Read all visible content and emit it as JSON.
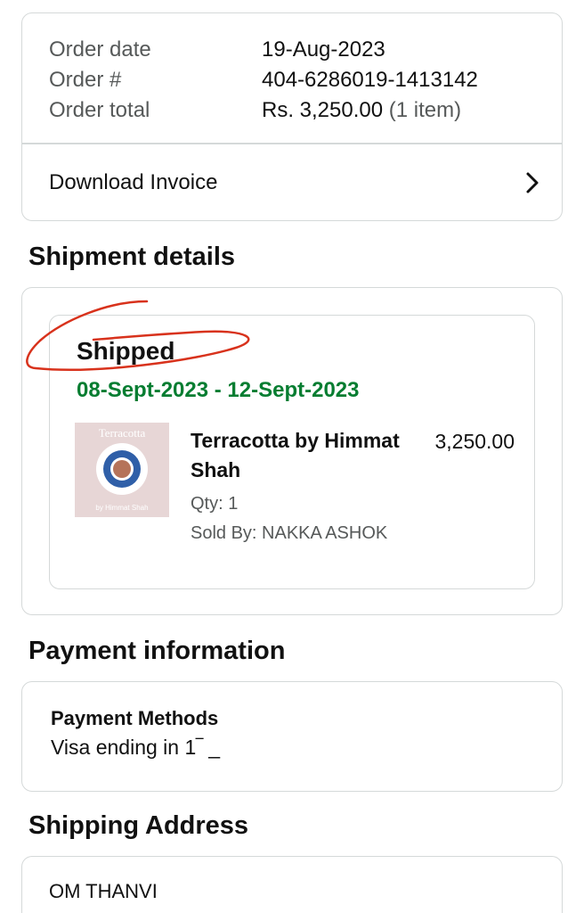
{
  "order_summary": {
    "rows": [
      {
        "label": "Order date",
        "value": "19-Aug-2023"
      },
      {
        "label": "Order #",
        "value": "404-6286019-1413142"
      },
      {
        "label": "Order total",
        "value": "Rs. 3,250.00",
        "note": "(1 item)"
      }
    ],
    "invoice_label": "Download Invoice",
    "chevron_icon": "chevron-right-icon"
  },
  "shipment": {
    "section_title": "Shipment details",
    "status": "Shipped",
    "delivery_window": "08-Sept-2023 - 12-Sept-2023",
    "item": {
      "thumb_title": "Terracotta",
      "thumb_author": "by Himmat Shah",
      "name": "Terracotta by Himmat Shah",
      "qty": "Qty: 1",
      "seller": "Sold By: NAKKA ASHOK",
      "price": "3,250.00"
    }
  },
  "payment": {
    "section_title": "Payment information",
    "methods_label": "Payment Methods",
    "method": "Visa  ending in 1‾  _"
  },
  "address": {
    "section_title": "Shipping Address",
    "name": "OM THANVI"
  },
  "colors": {
    "status_green": "#067d31",
    "annotation_red": "#d8321c",
    "border": "#d5d9d9",
    "muted_text": "#565959"
  }
}
